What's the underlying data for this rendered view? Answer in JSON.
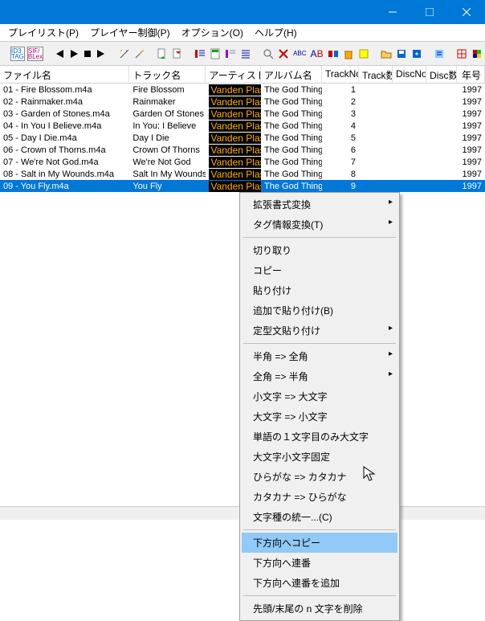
{
  "window": {
    "min": "min",
    "max": "max",
    "close": "close"
  },
  "menu": {
    "playlist": "プレイリスト(P)",
    "player": "プレイヤー制御(P)",
    "option": "オプション(O)",
    "help": "ヘルプ(H)"
  },
  "columns": {
    "file": "ファイル名",
    "track": "トラック名",
    "artist": "アーティスト名",
    "album": "アルバム名",
    "trackno": "TrackNo",
    "tracks": "Track数",
    "discno": "DiscNo",
    "discs": "Disc数",
    "year": "年号"
  },
  "rows": [
    {
      "file": "01 - Fire Blossom.m4a",
      "track": "Fire Blossom",
      "artist": "Vanden Plas",
      "album": "The God Thing",
      "trackno": "1",
      "year": "1997"
    },
    {
      "file": "02 - Rainmaker.m4a",
      "track": "Rainmaker",
      "artist": "Vanden Plas",
      "album": "The God Thing",
      "trackno": "2",
      "year": "1997"
    },
    {
      "file": "03 - Garden of Stones.m4a",
      "track": "Garden Of Stones",
      "artist": "Vanden Plas",
      "album": "The God Thing",
      "trackno": "3",
      "year": "1997"
    },
    {
      "file": "04 - In You I Believe.m4a",
      "track": "In You: I Believe",
      "artist": "Vanden Plas",
      "album": "The God Thing",
      "trackno": "4",
      "year": "1997"
    },
    {
      "file": "05 - Day I Die.m4a",
      "track": "Day I Die",
      "artist": "Vanden Plas",
      "album": "The God Thing",
      "trackno": "5",
      "year": "1997"
    },
    {
      "file": "06 - Crown of Thorns.m4a",
      "track": "Crown Of Thorns",
      "artist": "Vanden Plas",
      "album": "The God Thing",
      "trackno": "6",
      "year": "1997"
    },
    {
      "file": "07 - We're Not God.m4a",
      "track": "We're Not God",
      "artist": "Vanden Plas",
      "album": "The God Thing",
      "trackno": "7",
      "year": "1997"
    },
    {
      "file": "08 - Salt in My Wounds.m4a",
      "track": "Salt In My Wounds",
      "artist": "Vanden Plas",
      "album": "The God Thing",
      "trackno": "8",
      "year": "1997"
    },
    {
      "file": "09 - You Fly.m4a",
      "track": "You Fly",
      "artist": "Vanden Plas",
      "album": "The God Thing",
      "trackno": "9",
      "year": "1997",
      "selected": true
    }
  ],
  "context": {
    "ext_fmt": "拡張書式変換",
    "tag_info": "タグ情報変換(T)",
    "cut": "切り取り",
    "copy": "コピー",
    "paste": "貼り付け",
    "paste_add": "追加で貼り付け(B)",
    "paste_fixed": "定型文貼り付け",
    "half_full": "半角 => 全角",
    "full_half": "全角 => 半角",
    "lower_upper": "小文字 => 大文字",
    "upper_lower": "大文字 => 小文字",
    "first_cap": "単語の１文字目のみ大文字",
    "case_fix": "大文字小文字固定",
    "hira_kata": "ひらがな => カタカナ",
    "kata_hira": "カタカナ => ひらがな",
    "char_unify": "文字種の統一...(C)",
    "copy_down": "下方向へコピー",
    "seq_down": "下方向へ連番",
    "seq_add_down": "下方向へ連番を追加",
    "del_n": "先頭/末尾の n 文字を削除"
  }
}
